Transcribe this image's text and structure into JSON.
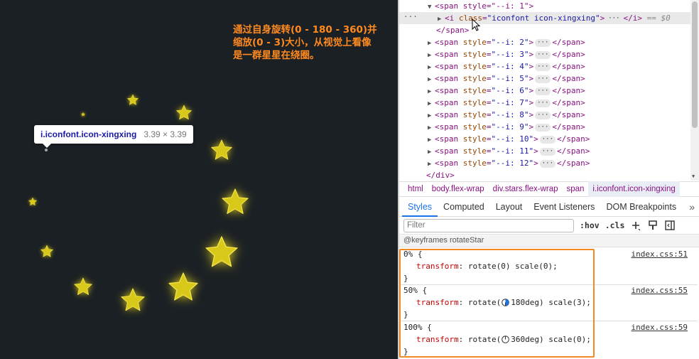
{
  "annotation": {
    "lines": [
      "通过自身旋转(0 - 180 - 360)并",
      "缩放(0 - 3)大小，从视觉上看像",
      "是一群星星在绕圈。"
    ]
  },
  "tooltip": {
    "selector": "i.iconfont.icon-xingxing",
    "dimensions": "3.39 × 3.39"
  },
  "colors": {
    "star_glow": "#d8c81a",
    "annotation": "#ff8a1f",
    "highlight_box": "#f08a24"
  },
  "dom_tree": {
    "span_open": "<span style=\"--i: 1\">",
    "i_line": {
      "tag_open": "<i",
      "attr": "class",
      "value": "\"iconfont icon-xingxing\"",
      "close": "</i>",
      "marker": "== $0"
    },
    "span_close": "</span>",
    "siblings": [
      {
        "label": "--i: 2"
      },
      {
        "label": "--i: 3"
      },
      {
        "label": "--i: 4"
      },
      {
        "label": "--i: 5"
      },
      {
        "label": "--i: 6"
      },
      {
        "label": "--i: 7"
      },
      {
        "label": "--i: 8"
      },
      {
        "label": "--i: 9"
      },
      {
        "label": "--i: 10"
      },
      {
        "label": "--i: 11"
      },
      {
        "label": "--i: 12"
      }
    ],
    "div_close": "</div>"
  },
  "breadcrumb": [
    "html",
    "body.flex-wrap",
    "div.stars.flex-wrap",
    "span",
    "i.iconfont.icon-xingxing"
  ],
  "tabs": [
    "Styles",
    "Computed",
    "Layout",
    "Event Listeners",
    "DOM Breakpoints"
  ],
  "filter": {
    "placeholder": "Filter",
    "hov": ":hov",
    "cls": ".cls"
  },
  "keyframes_header": "@keyframes rotateStar",
  "rules": [
    {
      "selector": "0% {",
      "property": "transform",
      "value_pre": "rotate(",
      "angle": "0",
      "value_post": ") scale(0);",
      "has_icon": false,
      "source": "index.css:51"
    },
    {
      "selector": "50% {",
      "property": "transform",
      "value_pre": "rotate(",
      "angle": "180deg",
      "value_post": ") scale(3);",
      "has_icon": true,
      "source": "index.css:55"
    },
    {
      "selector": "100% {",
      "property": "transform",
      "value_pre": "rotate(",
      "angle": "360deg",
      "value_post": ") scale(0);",
      "has_icon": true,
      "source": "index.css:59"
    }
  ]
}
